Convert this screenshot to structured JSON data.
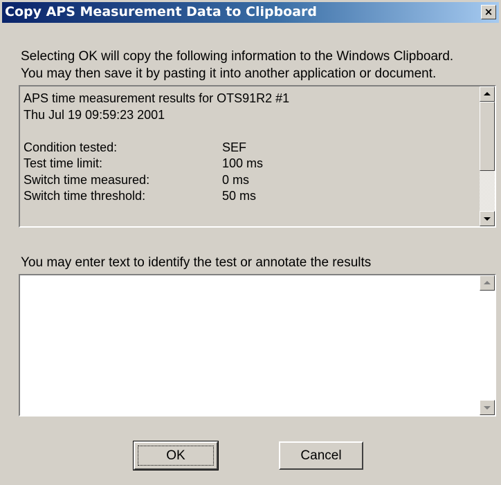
{
  "window": {
    "title": "Copy APS Measurement Data to Clipboard",
    "close_glyph": "×",
    "close_icon": "close-icon"
  },
  "description": [
    "Selecting OK will copy the following information to the Windows Clipboard.",
    "You may then save it by pasting it into another application or document."
  ],
  "results": {
    "heading": "APS time measurement results for OTS91R2 #1",
    "timestamp": "Thu Jul 19 09:59:23 2001",
    "rows": [
      {
        "label": "Condition tested:",
        "value": "SEF"
      },
      {
        "label": "Test time limit:",
        "value": "100 ms"
      },
      {
        "label": "Switch time measured:",
        "value": "0 ms"
      },
      {
        "label": "Switch time threshold:",
        "value": "50 ms"
      }
    ]
  },
  "annotation": {
    "label": "You may enter text to identify the test or annotate the results",
    "value": ""
  },
  "buttons": {
    "ok": "OK",
    "cancel": "Cancel"
  },
  "colors": {
    "title_bar_start": "#0a246a",
    "title_bar_end": "#a6caf0",
    "face": "#d4d0c8"
  }
}
